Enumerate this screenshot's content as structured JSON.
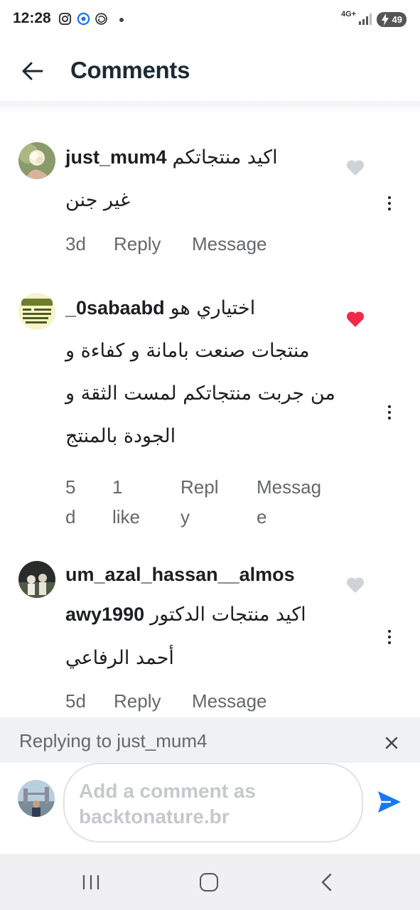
{
  "status_bar": {
    "time": "12:28",
    "network": "4G+",
    "battery": "49",
    "icons": [
      "instagram-icon",
      "messenger-icon",
      "threads-icon",
      "dot-icon",
      "signal-icon",
      "battery-icon"
    ]
  },
  "header": {
    "title": "Comments",
    "back_icon": "arrow-left-icon"
  },
  "comments": [
    {
      "username": "just_mum4",
      "lines": [
        "اكيد منتجاتكم",
        "غير جنن"
      ],
      "time": "3d",
      "likes": "",
      "reply_label": "Reply",
      "message_label": "Message",
      "liked": false
    },
    {
      "username": "_0sabaabd",
      "lines": [
        "اختياري هو",
        "منتجات صنعت بامانة و كفاءة و",
        "من جربت منتجاتكم لمست الثقة و",
        "الجودة بالمنتج"
      ],
      "time": "5\nd",
      "likes": "1\nlike",
      "reply_label": "Repl\ny",
      "message_label": "Messag\ne",
      "liked": true
    },
    {
      "username": "um_azal_hassan__almosawy1990",
      "username_lines": [
        "um_azal_hassan__almos",
        "awy1990"
      ],
      "lines": [
        "اكيد منتجات الدكتور",
        "أحمد الرفاعي"
      ],
      "time": "5d",
      "likes": "",
      "reply_label": "Reply",
      "message_label": "Message",
      "liked": false
    }
  ],
  "reply_bar": {
    "label": "Replying to just_mum4"
  },
  "composer": {
    "placeholder": "Add a comment as backtonature.br"
  },
  "colors": {
    "liked_heart": "#f02849",
    "unliked_heart": "#cfd2d6",
    "send": "#1877f2",
    "secondary_text": "#65676b"
  }
}
